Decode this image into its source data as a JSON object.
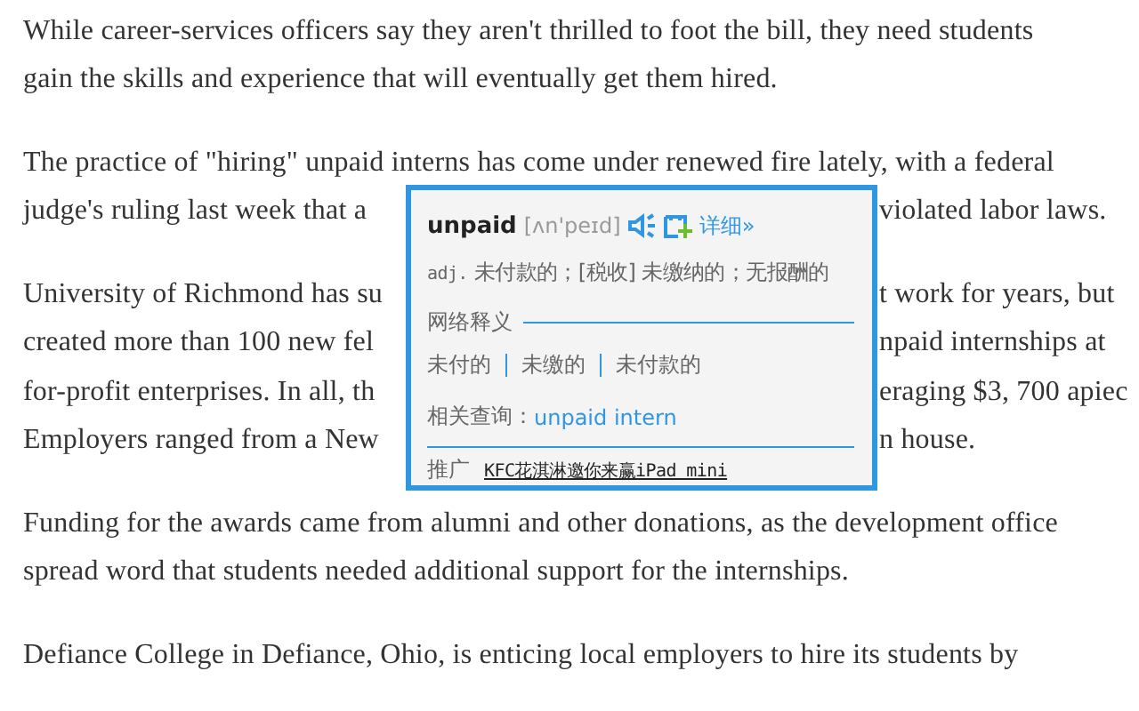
{
  "article": {
    "paragraphs": [
      {
        "lines": [
          {
            "left": "While career-services officers say they aren't thrilled to foot the bill, they need students"
          },
          {
            "left": "gain the skills and experience that will eventually get them hired."
          }
        ]
      },
      {
        "lines": [
          {
            "left": "The practice of \"hiring\" unpaid interns has come under renewed fire lately, with a federal"
          },
          {
            "left": "judge's ruling last week that a",
            "right": "violated labor laws."
          }
        ]
      },
      {
        "lines": [
          {
            "left": "University of Richmond has su",
            "right": "t work for years, but"
          },
          {
            "left": "created more than 100 new fel",
            "right": "npaid internships at"
          },
          {
            "left": "for-profit enterprises. In all, th",
            "right": "eraging $3, 700 apiec"
          },
          {
            "left": "Employers ranged from a New",
            "right": "n house."
          }
        ]
      },
      {
        "lines": [
          {
            "left": "Funding for the awards came from alumni and other donations, as the development office"
          },
          {
            "left": "spread word that students needed additional support for the internships."
          }
        ]
      },
      {
        "lines": [
          {
            "left": "Defiance College in Defiance, Ohio, is enticing local employers to hire its students by"
          }
        ]
      }
    ]
  },
  "popup": {
    "word": "unpaid",
    "phonetic": "[ʌn'peɪd]",
    "details_link": "详细»",
    "pos": "adj.",
    "definition": "未付款的；[税收] 未缴纳的；无报酬的",
    "web_heading": "网络释义",
    "web_meanings": [
      "未付的",
      "未缴的",
      "未付款的"
    ],
    "related_label": "相关查询：",
    "related_link": "unpaid intern",
    "promo_label": "推广",
    "promo_link": "KFC花淇淋邀你来赢iPad mini"
  }
}
